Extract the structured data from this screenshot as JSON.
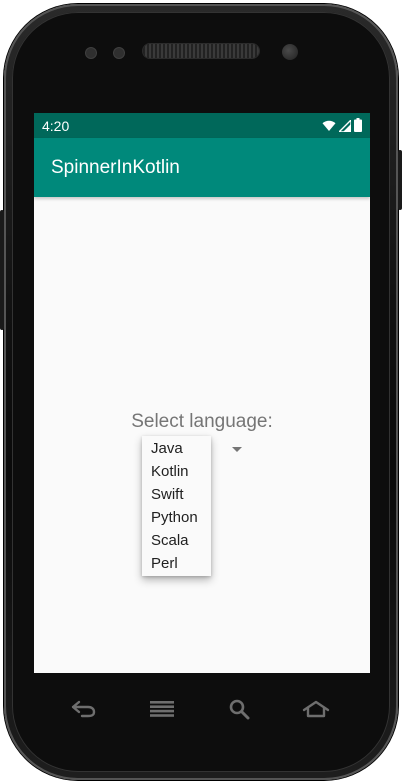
{
  "status_bar": {
    "time": "4:20",
    "icons": [
      "wifi-icon",
      "signal-icon",
      "battery-icon"
    ],
    "color": "#00685a"
  },
  "app_bar": {
    "title": "SpinnerInKotlin",
    "color": "#00897b"
  },
  "main": {
    "label": "Select language:",
    "spinner": {
      "selected": "Java",
      "options": [
        "Java",
        "Kotlin",
        "Swift",
        "Python",
        "Scala",
        "Perl"
      ]
    }
  },
  "nav_bar": {
    "buttons": [
      "back-icon",
      "menu-icon",
      "search-icon",
      "home-icon"
    ]
  }
}
